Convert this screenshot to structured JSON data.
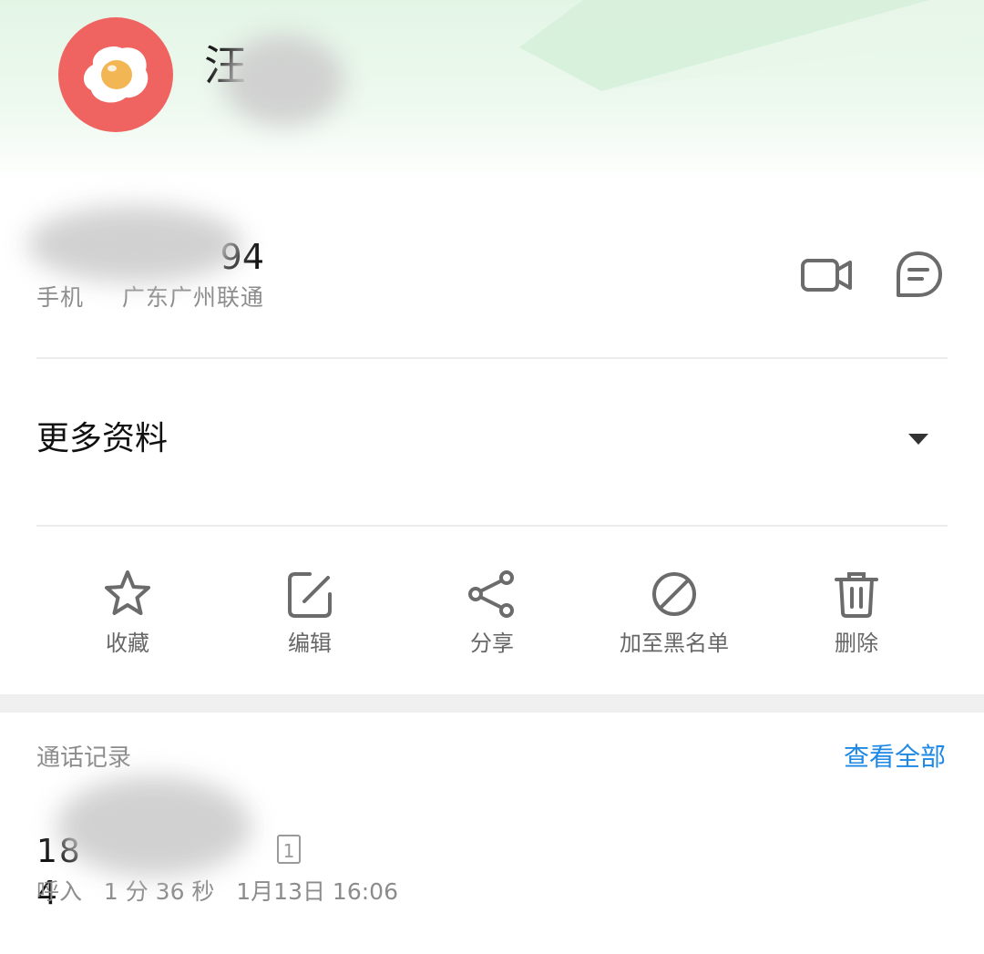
{
  "contact": {
    "name_visible": "汪",
    "phone": {
      "number_visible": "94",
      "type": "手机",
      "location": "广东广州联通"
    }
  },
  "more_info": {
    "label": "更多资料",
    "icon": "triangle-down-icon"
  },
  "quick_actions": {
    "video_call_icon": "video-camera-icon",
    "message_icon": "message-bubble-icon"
  },
  "actions": [
    {
      "label": "收藏",
      "icon": "star-icon"
    },
    {
      "label": "编辑",
      "icon": "edit-icon"
    },
    {
      "label": "分享",
      "icon": "share-icon"
    },
    {
      "label": "加至黑名单",
      "icon": "block-icon"
    },
    {
      "label": "删除",
      "icon": "trash-icon"
    }
  ],
  "call_log": {
    "title": "通话记录",
    "view_all_label": "查看全部",
    "entries": [
      {
        "number_prefix": "18",
        "number_suffix": "4",
        "sim": "1",
        "direction": "呼入",
        "duration": "1 分 36 秒",
        "time": "1月13日 16:06"
      }
    ]
  },
  "colors": {
    "header_green": "#e3f6e6",
    "avatar_red": "#ef6461",
    "link_blue": "#1e88e5",
    "icon_gray": "#6b6b6b"
  }
}
